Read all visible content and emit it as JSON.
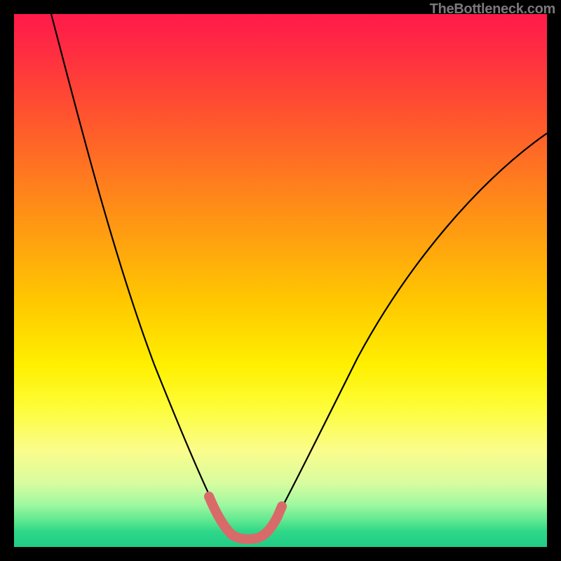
{
  "watermark": "TheBottleneck.com",
  "chart_data": {
    "type": "line",
    "title": "",
    "xlabel": "",
    "ylabel": "",
    "xlim": [
      0,
      100
    ],
    "ylim": [
      0,
      100
    ],
    "series": [
      {
        "name": "bottleneck-curve-left",
        "x": [
          7,
          10,
          15,
          20,
          25,
          30,
          33,
          36,
          38,
          40
        ],
        "y": [
          100,
          88,
          70,
          52,
          35,
          20,
          12,
          6,
          3,
          1
        ]
      },
      {
        "name": "bottleneck-curve-right",
        "x": [
          48,
          50,
          53,
          58,
          65,
          73,
          82,
          92,
          100
        ],
        "y": [
          1,
          3,
          7,
          15,
          28,
          42,
          56,
          68,
          78
        ]
      },
      {
        "name": "optimal-zone-highlight",
        "x": [
          36,
          38,
          40,
          42,
          44,
          46,
          48,
          50
        ],
        "y": [
          6,
          3,
          1,
          0.5,
          0.5,
          1,
          2,
          4
        ]
      }
    ],
    "colors": {
      "curve": "#000000",
      "highlight": "#d96a6a",
      "gradient_top": "#ff1a4a",
      "gradient_bottom": "#20cc86"
    }
  }
}
